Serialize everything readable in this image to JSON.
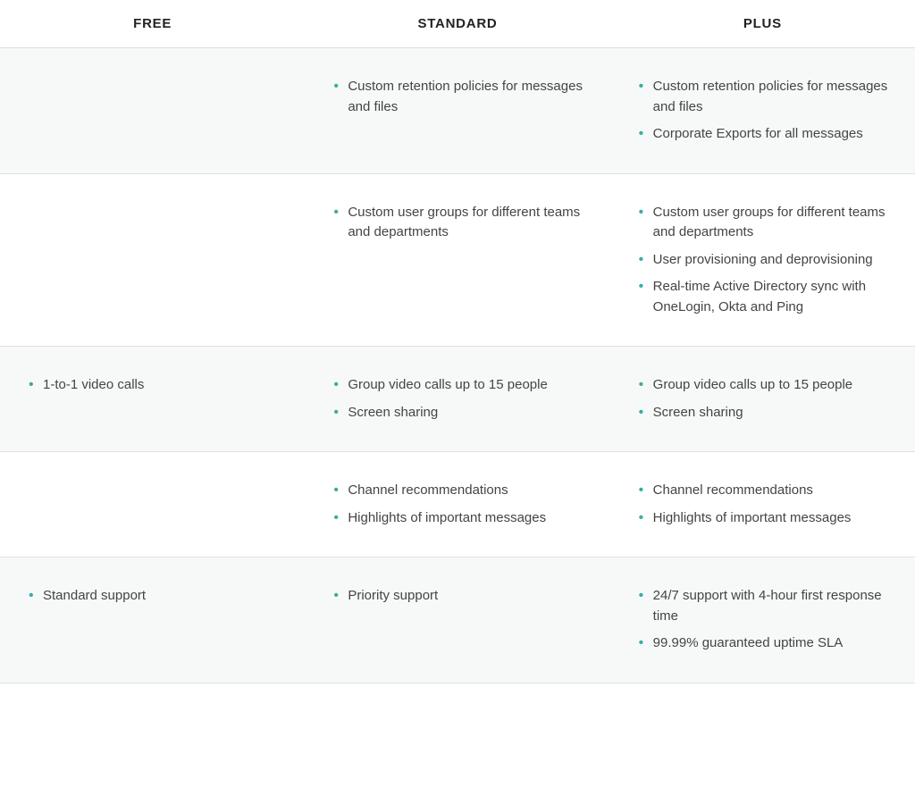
{
  "headers": {
    "free": "FREE",
    "standard": "STANDARD",
    "plus": "PLUS"
  },
  "rows": [
    {
      "free": [],
      "standard": [
        "Custom retention policies for messages and files"
      ],
      "plus": [
        "Custom retention policies for messages and files",
        "Corporate Exports for all messages"
      ]
    },
    {
      "free": [],
      "standard": [
        "Custom user groups for different teams and departments"
      ],
      "plus": [
        "Custom user groups for different teams and departments",
        "User provisioning and deprovisioning",
        "Real-time Active Directory sync with OneLogin, Okta and Ping"
      ]
    },
    {
      "free": [
        "1-to-1 video calls"
      ],
      "standard": [
        "Group video calls up to 15 people",
        "Screen sharing"
      ],
      "plus": [
        "Group video calls up to 15 people",
        "Screen sharing"
      ]
    },
    {
      "free": [],
      "standard": [
        "Channel recommendations",
        "Highlights of important messages"
      ],
      "plus": [
        "Channel recommendations",
        "Highlights of important messages"
      ]
    },
    {
      "free": [
        "Standard support"
      ],
      "standard": [
        "Priority support"
      ],
      "plus": [
        "24/7 support with 4-hour first response time",
        "99.99% guaranteed uptime SLA"
      ]
    }
  ]
}
